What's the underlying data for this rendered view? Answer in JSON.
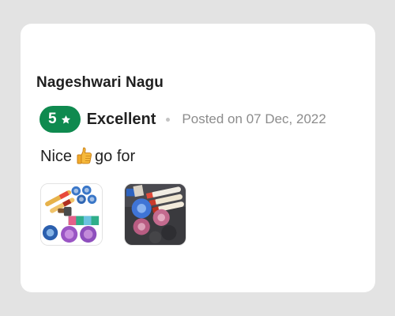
{
  "review": {
    "reviewer_name": "Nageshwari Nagu",
    "rating": "5",
    "rating_label": "Excellent",
    "posted": "Posted on 07 Dec, 2022",
    "comment_before": "Nice",
    "comment_emoji": "thumbs-up-icon",
    "comment_after": "go for",
    "photos": [
      {
        "name": "review-photo-1",
        "icon": "product-collage-image"
      },
      {
        "name": "review-photo-2",
        "icon": "product-dark-image"
      }
    ]
  },
  "colors": {
    "background": "#e3e3e3",
    "card": "#ffffff",
    "badge": "#0f8a4f",
    "muted_text": "#8c8c8c"
  }
}
